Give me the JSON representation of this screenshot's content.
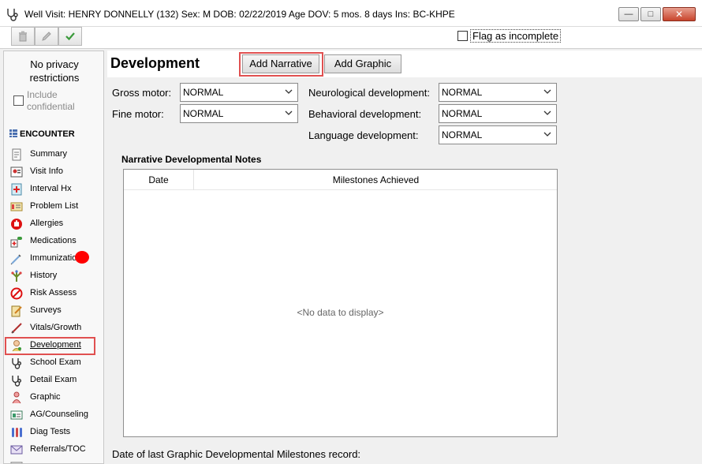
{
  "window": {
    "title": "Well Visit: HENRY DONNELLY (132)  Sex: M  DOB: 02/22/2019  Age DOV: 5 mos. 8 days  Ins: BC-KHPE",
    "minimize_glyph": "—",
    "maximize_glyph": "□",
    "close_glyph": "✕"
  },
  "toolbar": {
    "flag_label": "Flag as incomplete",
    "flag_checked": false
  },
  "sidebar": {
    "privacy_line1": "No privacy",
    "privacy_line2": "restrictions",
    "include_conf_line1": "Include",
    "include_conf_line2": "confidential",
    "section_header": "ENCOUNTER",
    "items": [
      {
        "label": "Summary",
        "icon": "summary-icon"
      },
      {
        "label": "Visit Info",
        "icon": "visit-info-icon"
      },
      {
        "label": "Interval Hx",
        "icon": "interval-hx-icon"
      },
      {
        "label": "Problem List",
        "icon": "problem-list-icon"
      },
      {
        "label": "Allergies",
        "icon": "allergies-icon"
      },
      {
        "label": "Medications",
        "icon": "medications-icon"
      },
      {
        "label": "Immunizatio",
        "icon": "immunization-icon"
      },
      {
        "label": "History",
        "icon": "history-icon"
      },
      {
        "label": "Risk Assess",
        "icon": "risk-assess-icon"
      },
      {
        "label": "Surveys",
        "icon": "surveys-icon"
      },
      {
        "label": "Vitals/Growth",
        "icon": "vitals-growth-icon"
      },
      {
        "label": "Development",
        "icon": "development-icon"
      },
      {
        "label": "School Exam",
        "icon": "stethoscope-icon"
      },
      {
        "label": "Detail Exam",
        "icon": "stethoscope-icon"
      },
      {
        "label": "Graphic",
        "icon": "graphic-icon"
      },
      {
        "label": "AG/Counseling",
        "icon": "counseling-icon"
      },
      {
        "label": "Diag Tests",
        "icon": "diag-tests-icon"
      },
      {
        "label": "Referrals/TOC",
        "icon": "referrals-icon"
      }
    ]
  },
  "main": {
    "title": "Development",
    "add_narrative": "Add Narrative",
    "add_graphic": "Add Graphic",
    "fields": {
      "gross_motor": {
        "label": "Gross motor:",
        "value": "NORMAL"
      },
      "fine_motor": {
        "label": "Fine motor:",
        "value": "NORMAL"
      },
      "neurological": {
        "label": "Neurological development:",
        "value": "NORMAL"
      },
      "behavioral": {
        "label": "Behavioral development:",
        "value": "NORMAL"
      },
      "language": {
        "label": "Language development:",
        "value": "NORMAL"
      }
    },
    "notes_title": "Narrative Developmental Notes",
    "columns": {
      "date": "Date",
      "milestones": "Milestones Achieved"
    },
    "empty_message": "<No data to display>",
    "last_record_label": "Date of last Graphic Developmental Milestones record:"
  },
  "colors": {
    "highlight": "#e05050",
    "alert_dot": "#ff0000",
    "check_green": "#3a9a3a"
  }
}
